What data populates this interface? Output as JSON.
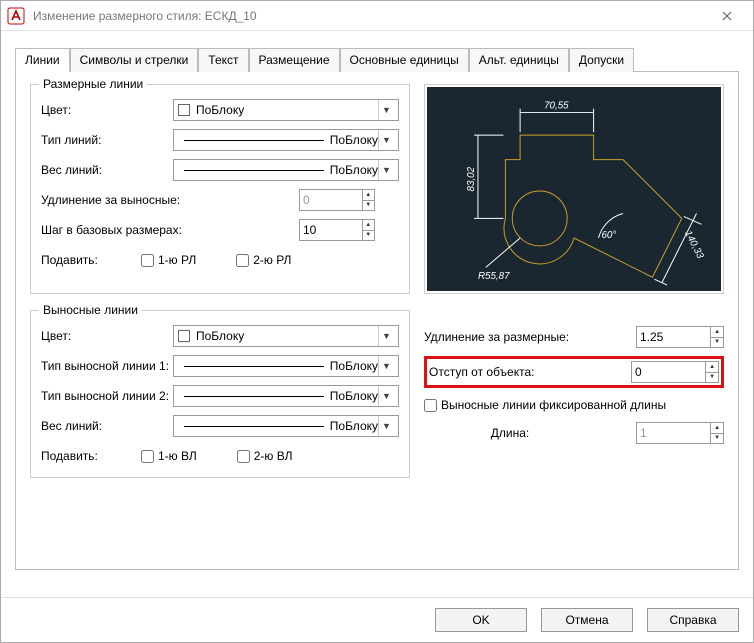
{
  "window": {
    "title": "Изменение размерного стиля: ЕСКД_10"
  },
  "tabs": [
    "Линии",
    "Символы и стрелки",
    "Текст",
    "Размещение",
    "Основные единицы",
    "Альт. единицы",
    "Допуски"
  ],
  "dim_lines": {
    "group_title": "Размерные линии",
    "color_label": "Цвет:",
    "color_value": "ПоБлоку",
    "linetype_label": "Тип линий:",
    "linetype_value": "ПоБлоку",
    "lineweight_label": "Вес линий:",
    "lineweight_value": "ПоБлоку",
    "extend_label": "Удлинение за выносные:",
    "extend_value": "0",
    "baseline_label": "Шаг в базовых размерах:",
    "baseline_value": "10",
    "suppress_label": "Подавить:",
    "suppress_1": "1-ю РЛ",
    "suppress_2": "2-ю РЛ"
  },
  "ext_lines": {
    "group_title": "Выносные линии",
    "color_label": "Цвет:",
    "color_value": "ПоБлоку",
    "linetype1_label": "Тип выносной линии 1:",
    "linetype1_value": "ПоБлоку",
    "linetype2_label": "Тип выносной линии 2:",
    "linetype2_value": "ПоБлоку",
    "lineweight_label": "Вес линий:",
    "lineweight_value": "ПоБлоку",
    "suppress_label": "Подавить:",
    "suppress_1": "1-ю ВЛ",
    "suppress_2": "2-ю ВЛ"
  },
  "ext_right": {
    "extend_label": "Удлинение за размерные:",
    "extend_value": "1.25",
    "offset_label": "Отступ от объекта:",
    "offset_value": "0",
    "fixed_label": "Выносные линии фиксированной длины",
    "length_label": "Длина:",
    "length_value": "1"
  },
  "preview_dims": {
    "top": "70,55",
    "left": "83,02",
    "radius": "R55,87",
    "angle": "60°",
    "right": "140,33"
  },
  "buttons": {
    "ok": "OK",
    "cancel": "Отмена",
    "help": "Справка"
  }
}
